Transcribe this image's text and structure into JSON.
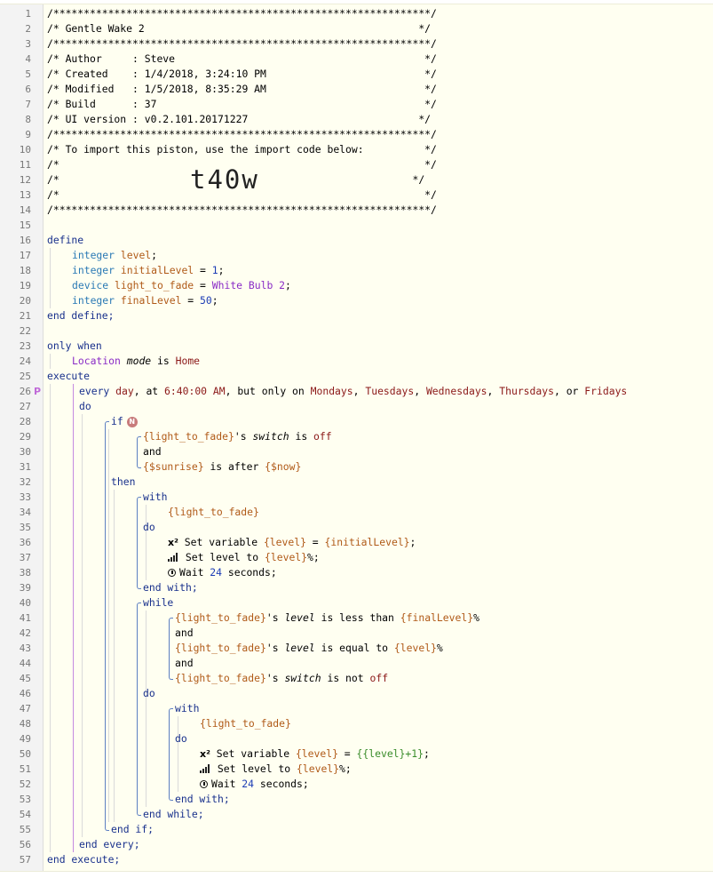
{
  "header": {
    "rule": "/**************************************************************/",
    "title": "/* Gentle Wake 2                                             */",
    "author": "/* Author     : Steve                                         */",
    "created": "/* Created    : 1/4/2018, 3:24:10 PM                          */",
    "modified": "/* Modified   : 1/5/2018, 8:35:29 AM                          */",
    "build": "/* Build      : 37                                            */",
    "ui_version": "/* UI version : v0.2.101.20171227                            */",
    "import_note": "/* To import this piston, use the import code below:          */",
    "blank_comment": "/*                                                            */",
    "import_prefix": "/*",
    "import_suffix": "*/",
    "import_code": "t40w"
  },
  "kw": {
    "define": "define",
    "end_define": "end define;",
    "only_when": "only when",
    "execute": "execute",
    "every": "every",
    "do": "do",
    "if": "if",
    "and": "and",
    "then": "then",
    "with": "with",
    "end_with": "end with;",
    "while": "while",
    "end_while": "end while;",
    "end_if": "end if;",
    "end_every": "end every;",
    "end_execute": "end execute;",
    "integer": "integer",
    "device": "device",
    "is": "is",
    "is_after": "is after",
    "is_less_than": "is less than",
    "is_equal_to": "is equal to",
    "is_not": "is not"
  },
  "defines": {
    "level": "level",
    "initialLevel": "initialLevel",
    "initialLevel_value": "1",
    "light_to_fade": "light_to_fade",
    "light_to_fade_value": "White Bulb 2",
    "finalLevel": "finalLevel",
    "finalLevel_value": "50"
  },
  "condition": {
    "location": "Location",
    "mode": "mode",
    "home": "Home"
  },
  "every_stmt": {
    "day": "day",
    "at": "at",
    "time": "6:40:00 AM",
    "but_only_on": "but only on",
    "days": [
      "Mondays",
      "Tuesdays",
      "Wednesdays",
      "Thursdays",
      "Fridays"
    ],
    "or": "or"
  },
  "exprs": {
    "light_to_fade": "{light_to_fade}",
    "possessive": "'s",
    "switch": "switch",
    "off": "off",
    "sunrise": "{$sunrise}",
    "now": "{$now}",
    "level_var": "{level}",
    "initialLevel_var": "{initialLevel}",
    "finalLevel_var": "{finalLevel}",
    "level_attr": "level",
    "incr": "{{level}+1}",
    "percent": "%"
  },
  "actions": {
    "set_variable": "Set variable",
    "set_level_to": "Set level to",
    "wait": "Wait",
    "wait_value": "24",
    "seconds": "seconds;"
  },
  "line_numbers": [
    "1",
    "2",
    "3",
    "4",
    "5",
    "6",
    "7",
    "8",
    "9",
    "10",
    "11",
    "12",
    "13",
    "14",
    "15",
    "16",
    "17",
    "18",
    "19",
    "20",
    "21",
    "22",
    "23",
    "24",
    "25",
    "26",
    "27",
    "28",
    "29",
    "30",
    "31",
    "32",
    "33",
    "34",
    "35",
    "36",
    "37",
    "38",
    "39",
    "40",
    "41",
    "42",
    "43",
    "44",
    "45",
    "46",
    "47",
    "48",
    "49",
    "50",
    "51",
    "52",
    "53",
    "54",
    "55",
    "56",
    "57"
  ],
  "icons": {
    "badge": "N",
    "gutter_marker": "P",
    "variable_icon": "x²",
    "signal_icon": "signal-icon",
    "clock_icon": "clock-icon"
  }
}
